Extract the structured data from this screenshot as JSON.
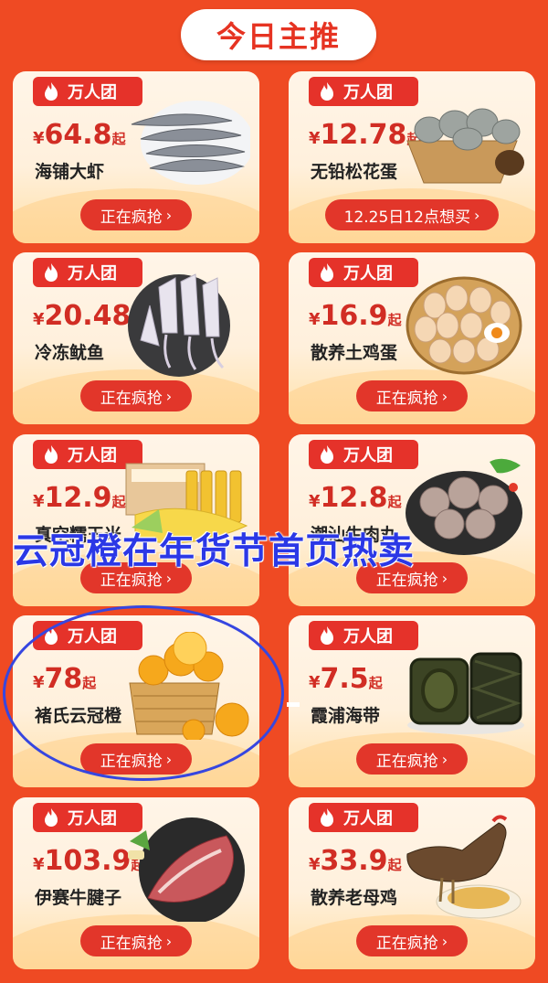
{
  "header": {
    "title": "今日主推"
  },
  "badge_label": "万人团",
  "currency": "¥",
  "price_suffix": "起",
  "products": [
    {
      "price": "64.8",
      "name": "海铺大虾",
      "button": "正在疯抢",
      "icon": "shrimp-image"
    },
    {
      "price": "12.78",
      "name": "无铅松花蛋",
      "button": "12.25日12点想买",
      "icon": "century-egg-image"
    },
    {
      "price": "20.48",
      "name": "冷冻鱿鱼",
      "button": "正在疯抢",
      "icon": "squid-image"
    },
    {
      "price": "16.9",
      "name": "散养土鸡蛋",
      "button": "正在疯抢",
      "icon": "eggs-image"
    },
    {
      "price": "12.9",
      "name": "真空糯玉米",
      "button": "正在疯抢",
      "icon": "corn-image"
    },
    {
      "price": "12.8",
      "name": "潮汕牛肉丸",
      "button": "正在疯抢",
      "icon": "beef-ball-image"
    },
    {
      "price": "78",
      "name": "褚氏云冠橙",
      "button": "正在疯抢",
      "icon": "orange-image"
    },
    {
      "price": "7.5",
      "name": "霞浦海带",
      "button": "正在疯抢",
      "icon": "kelp-image"
    },
    {
      "price": "103.9",
      "name": "伊赛牛腱子",
      "button": "正在疯抢",
      "icon": "beef-shank-image"
    },
    {
      "price": "33.9",
      "name": "散养老母鸡",
      "button": "正在疯抢",
      "icon": "hen-image"
    }
  ],
  "overlay_caption": "云冠橙在年货节首页热卖",
  "colors": {
    "background": "#ef4a23",
    "accent": "#e5322a",
    "price": "#d12d24",
    "annotation": "#2b38e6"
  }
}
